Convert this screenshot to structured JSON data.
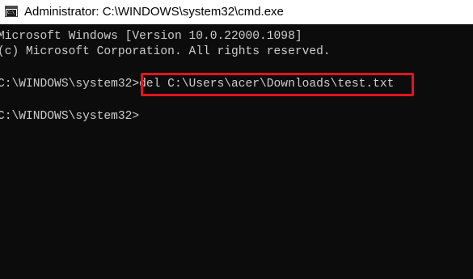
{
  "window": {
    "title": "Administrator: C:\\WINDOWS\\system32\\cmd.exe",
    "icon": "cmd-icon",
    "icon_text": "C:\\"
  },
  "console": {
    "lines": [
      "Microsoft Windows [Version 10.0.22000.1098]",
      "(c) Microsoft Corporation. All rights reserved."
    ],
    "prompt": "C:\\WINDOWS\\system32>",
    "command": "del C:\\Users\\acer\\Downloads\\test.txt",
    "second_prompt": "C:\\WINDOWS\\system32>"
  },
  "colors": {
    "background": "#0c0c0c",
    "text": "#cccccc",
    "highlight": "#e0141e",
    "titlebar": "#ffffff"
  }
}
